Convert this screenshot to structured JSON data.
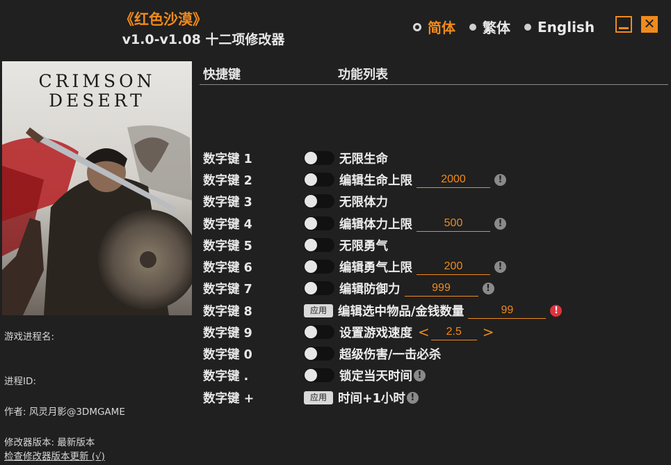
{
  "header": {
    "game_title": "《红色沙漠》",
    "subtitle": "v1.0-v1.08 十二项修改器"
  },
  "languages": [
    {
      "label": "简体",
      "selected": true
    },
    {
      "label": "繁体",
      "selected": false
    },
    {
      "label": "English",
      "selected": false
    }
  ],
  "window": {
    "minimize_icon": "minimize-icon",
    "close_icon": "close-icon",
    "close_glyph": "✕"
  },
  "cover": {
    "logo_line1": "CRIMSON",
    "logo_line2": "DESERT"
  },
  "info": {
    "process_name_label": "游戏进程名:",
    "process_id_label": "进程ID:",
    "author": "作者: 风灵月影@3DMGAME",
    "version": "修改器版本: 最新版本",
    "update_link": "检查修改器版本更新 (√)"
  },
  "columns": {
    "hotkey": "快捷键",
    "features": "功能列表"
  },
  "rows": [
    {
      "key": "数字键 1",
      "control": "toggle",
      "name": "无限生命"
    },
    {
      "key": "数字键 2",
      "control": "toggle",
      "name": "编辑生命上限",
      "value": "2000",
      "hint": "!"
    },
    {
      "key": "数字键 3",
      "control": "toggle",
      "name": "无限体力"
    },
    {
      "key": "数字键 4",
      "control": "toggle",
      "name": "编辑体力上限",
      "value": "500",
      "hint": "!"
    },
    {
      "key": "数字键 5",
      "control": "toggle",
      "name": "无限勇气"
    },
    {
      "key": "数字键 6",
      "control": "toggle",
      "name": "编辑勇气上限",
      "value": "200",
      "hint": "!"
    },
    {
      "key": "数字键 7",
      "control": "toggle",
      "name": "编辑防御力",
      "value": "999",
      "hint": "!"
    },
    {
      "key": "数字键 8",
      "control": "apply",
      "apply_label": "应用",
      "name": "编辑选中物品/金钱数量",
      "value": "99",
      "hint": "!"
    },
    {
      "key": "数字键 9",
      "control": "toggle",
      "name": "设置游戏速度",
      "value": "2.5",
      "left_arrow": "<",
      "right_arrow": ">"
    },
    {
      "key": "数字键 0",
      "control": "toggle",
      "name": "超级伤害/一击必杀"
    },
    {
      "key": "数字键 .",
      "control": "toggle",
      "name": "锁定当天时间",
      "hint": "!"
    },
    {
      "key": "数字键 +",
      "control": "apply",
      "apply_label": "应用",
      "name": "时间+1小时",
      "hint": "!"
    }
  ],
  "colors": {
    "accent": "#f08a1c",
    "background": "#202020",
    "warning": "#e0323c"
  }
}
